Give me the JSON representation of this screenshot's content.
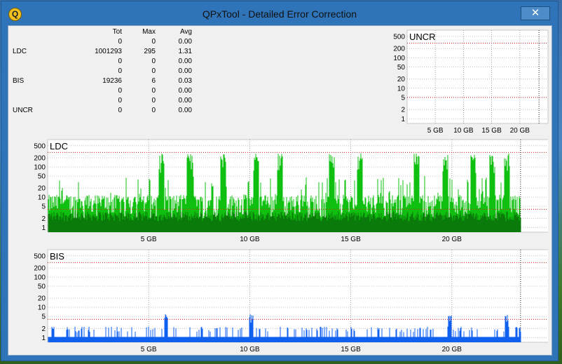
{
  "window": {
    "title": "QPxTool - Detailed Error Correction",
    "close_glyph": "✕",
    "app_icon_glyph": "Q"
  },
  "stats": {
    "headers": [
      "Tot",
      "Max",
      "Avg"
    ],
    "rows": [
      {
        "label": "",
        "tot": "0",
        "max": "0",
        "avg": "0.00"
      },
      {
        "label": "LDC",
        "tot": "1001293",
        "max": "295",
        "avg": "1.31"
      },
      {
        "label": "",
        "tot": "0",
        "max": "0",
        "avg": "0.00"
      },
      {
        "label": "",
        "tot": "0",
        "max": "0",
        "avg": "0.00"
      },
      {
        "label": "BIS",
        "tot": "19236",
        "max": "6",
        "avg": "0.03"
      },
      {
        "label": "",
        "tot": "0",
        "max": "0",
        "avg": "0.00"
      },
      {
        "label": "",
        "tot": "0",
        "max": "0",
        "avg": "0.00"
      },
      {
        "label": "UNCR",
        "tot": "0",
        "max": "0",
        "avg": "0.00"
      }
    ]
  },
  "chart_data": [
    {
      "type": "bar",
      "title": "UNCR",
      "y_scale": "log",
      "y_ticks": [
        "500",
        "200",
        "100",
        "50",
        "20",
        "10",
        "5",
        "2",
        "1"
      ],
      "x_ticks": [
        "5 GB",
        "10 GB",
        "15 GB",
        "20 GB"
      ],
      "x_range_gb": [
        0,
        25
      ],
      "data_end_gb": 23.4,
      "threshold_lines": [
        5,
        300
      ],
      "series": [
        {
          "color": "#cc0000",
          "values": []
        }
      ]
    },
    {
      "type": "bar",
      "title": "LDC",
      "y_scale": "log",
      "y_ticks": [
        "500",
        "200",
        "100",
        "50",
        "20",
        "10",
        "5",
        "2",
        "1"
      ],
      "x_ticks": [
        "5 GB",
        "10 GB",
        "15 GB",
        "20 GB"
      ],
      "x_range_gb": [
        0,
        25
      ],
      "data_end_gb": 23.4,
      "threshold_lines": [
        4,
        300
      ],
      "max": 295,
      "series": [
        {
          "color": "#10c010",
          "values": []
        }
      ]
    },
    {
      "type": "bar",
      "title": "BIS",
      "y_scale": "log",
      "y_ticks": [
        "500",
        "200",
        "100",
        "50",
        "20",
        "10",
        "5",
        "2",
        "1"
      ],
      "x_ticks": [
        "5 GB",
        "10 GB",
        "15 GB",
        "20 GB"
      ],
      "x_range_gb": [
        0,
        25
      ],
      "data_end_gb": 23.4,
      "threshold_lines": [
        4,
        300
      ],
      "max": 6,
      "series": [
        {
          "color": "#1060f0",
          "values": []
        }
      ]
    }
  ]
}
